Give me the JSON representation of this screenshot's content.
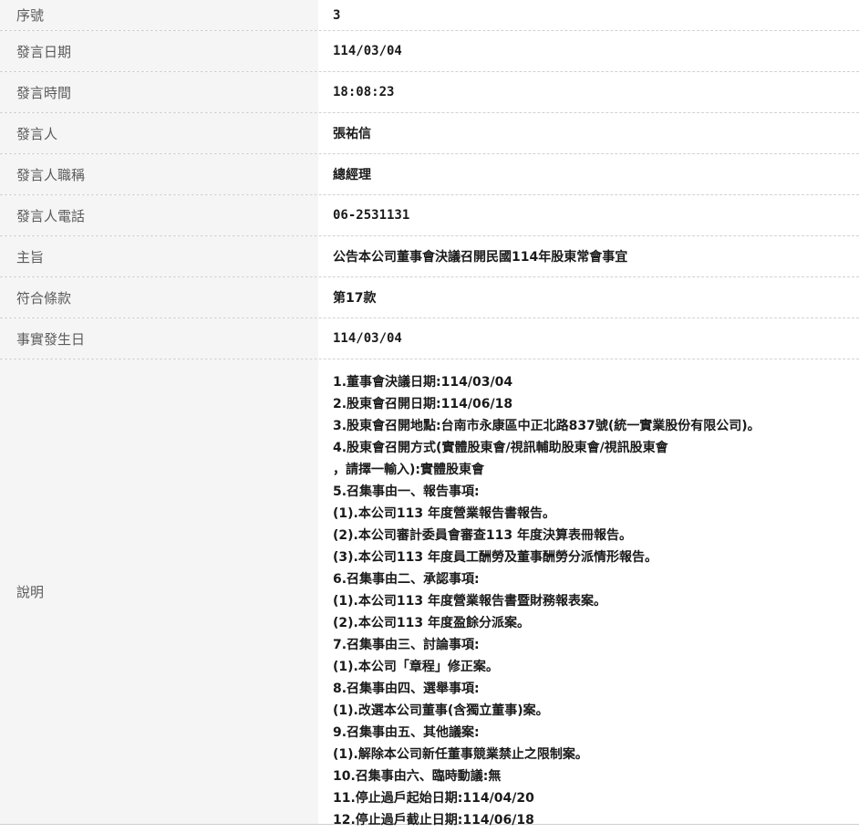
{
  "rows": [
    {
      "label": "序號",
      "value": "3"
    },
    {
      "label": "發言日期",
      "value": "114/03/04"
    },
    {
      "label": "發言時間",
      "value": "18:08:23"
    },
    {
      "label": "發言人",
      "value": "張祐信"
    },
    {
      "label": "發言人職稱",
      "value": "總經理"
    },
    {
      "label": "發言人電話",
      "value": "06-2531131"
    },
    {
      "label": "主旨",
      "value": "公告本公司董事會決議召開民國114年股東常會事宜"
    },
    {
      "label": "符合條款",
      "value": "第17款"
    },
    {
      "label": "事實發生日",
      "value": "114/03/04"
    }
  ],
  "description": {
    "label": "說明",
    "lines": [
      "1.董事會決議日期:114/03/04",
      "2.股東會召開日期:114/06/18",
      "3.股東會召開地點:台南市永康區中正北路837號(統一實業股份有限公司)。",
      "4.股東會召開方式(實體股東會/視訊輔助股東會/視訊股東會",
      "，請擇一輸入):實體股東會",
      "5.召集事由一、報告事項:",
      "(1).本公司113 年度營業報告書報告。",
      "(2).本公司審計委員會審查113 年度決算表冊報告。",
      "(3).本公司113 年度員工酬勞及董事酬勞分派情形報告。",
      "6.召集事由二、承認事項:",
      "(1).本公司113 年度營業報告書暨財務報表案。",
      "(2).本公司113 年度盈餘分派案。",
      "7.召集事由三、討論事項:",
      "(1).本公司「章程」修正案。",
      "8.召集事由四、選舉事項:",
      "(1).改選本公司董事(含獨立董事)案。",
      "9.召集事由五、其他議案:",
      "(1).解除本公司新任董事競業禁止之限制案。",
      "10.召集事由六、臨時動議:無",
      "11.停止過戶起始日期:114/04/20",
      "12.停止過戶截止日期:114/06/18"
    ]
  }
}
